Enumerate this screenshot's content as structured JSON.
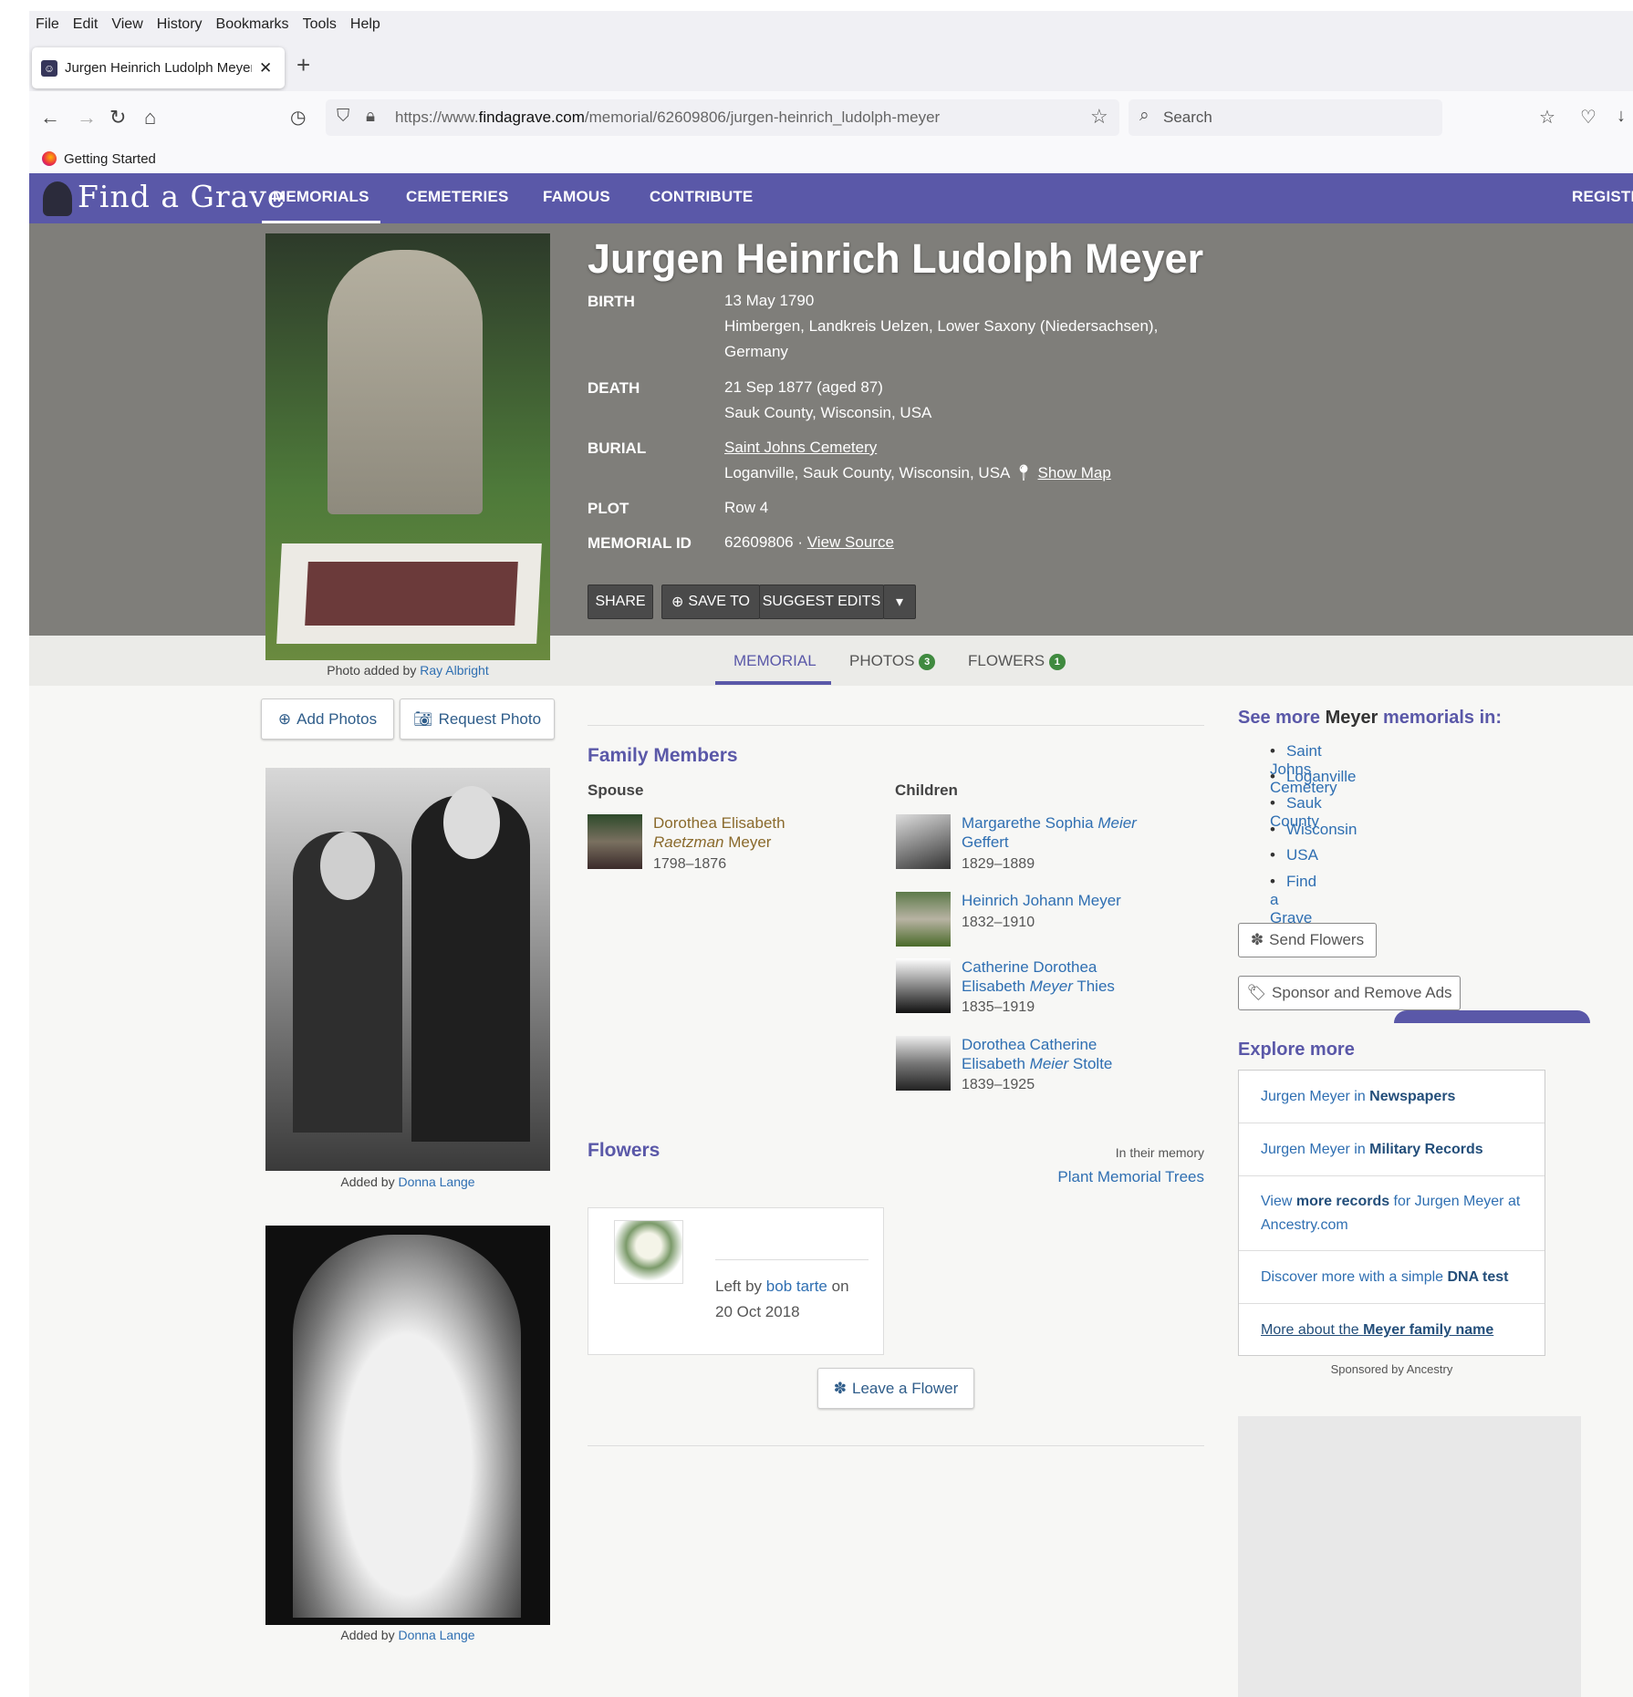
{
  "browser": {
    "menu": [
      "File",
      "Edit",
      "View",
      "History",
      "Bookmarks",
      "Tools",
      "Help"
    ],
    "tab_title": "Jurgen Heinrich Ludolph Meyer",
    "url_prefix": "https://www.",
    "url_domain": "findagrave.com",
    "url_path": "/memorial/62609806/jurgen-heinrich_ludolph-meyer",
    "search_placeholder": "Search",
    "bookmark": "Getting Started"
  },
  "site": {
    "logo": "Find a Grave",
    "nav": [
      "MEMORIALS",
      "CEMETERIES",
      "FAMOUS",
      "CONTRIBUTE"
    ],
    "register": "REGISTE"
  },
  "memorial": {
    "name": "Jurgen Heinrich Ludolph Meyer",
    "photo_caption_prefix": "Photo added by",
    "photo_caption_user": "Ray Albright",
    "birth_label": "BIRTH",
    "birth_date": "13 May 1790",
    "birth_place_1": "Himbergen, Landkreis Uelzen, Lower Saxony (Niedersachsen),",
    "birth_place_2": "Germany",
    "death_label": "DEATH",
    "death_date": "21 Sep 1877 (aged 87)",
    "death_place": "Sauk County, Wisconsin, USA",
    "burial_label": "BURIAL",
    "burial_cemetery": "Saint Johns Cemetery",
    "burial_place": "Loganville, Sauk County, Wisconsin, USA",
    "show_map": "Show Map",
    "plot_label": "PLOT",
    "plot": "Row 4",
    "memorial_id_label": "MEMORIAL ID",
    "memorial_id": "62609806 ·",
    "view_source": "View Source",
    "share": "SHARE",
    "save_to": "SAVE TO",
    "suggest_edits": "SUGGEST EDITS"
  },
  "tabs": {
    "memorial": "MEMORIAL",
    "photos": "PHOTOS",
    "photos_count": "3",
    "flowers": "FLOWERS",
    "flowers_count": "1"
  },
  "left": {
    "add_photos": "Add Photos",
    "request_photo": "Request Photo",
    "added_by": "Added by",
    "photo2_user": "Donna Lange",
    "photo3_user": "Donna Lange"
  },
  "family": {
    "title": "Family Members",
    "spouse_label": "Spouse",
    "children_label": "Children",
    "spouse": {
      "line1": "Dorothea Elisabeth",
      "line2_italic": "Raetzman",
      "line2_rest": " Meyer",
      "years": "1798–1876"
    },
    "children": [
      {
        "line1a": "Margarethe Sophia ",
        "line1_italic": "Meier",
        "line2": "Geffert",
        "years": "1829–1889"
      },
      {
        "line1a": "Heinrich Johann Meyer",
        "line1_italic": "",
        "line2": "",
        "years": "1832–1910"
      },
      {
        "line1a": "Catherine Dorothea",
        "line1_italic": "",
        "line2a": "Elisabeth ",
        "line2_italic": "Meyer",
        "line2": " Thies",
        "years": "1835–1919"
      },
      {
        "line1a": "Dorothea Catherine",
        "line1_italic": "",
        "line2a": "Elisabeth ",
        "line2_italic": "Meier",
        "line2": " Stolte",
        "years": "1839–1925"
      }
    ]
  },
  "flowers": {
    "title": "Flowers",
    "in_memory": "In their memory",
    "plant_trees": "Plant Memorial Trees",
    "left_by": "Left by",
    "left_by_user": "bob tarte",
    "left_on": "on",
    "left_date": "20 Oct 2018",
    "leave_flower": "Leave a Flower"
  },
  "sidebar": {
    "see_more_prefix": "See more",
    "see_more_name": "Meyer",
    "see_more_suffix": "memorials in:",
    "places": [
      "Saint Johns Cemetery",
      "Loganville",
      "Sauk County",
      "Wisconsin",
      "USA",
      "Find a Grave"
    ],
    "send_flowers": "Send Flowers",
    "sponsor": "Sponsor and Remove Ads",
    "explore_title": "Explore more",
    "explore": [
      {
        "pre": "Jurgen Meyer in ",
        "bold": "Newspapers",
        "post": ""
      },
      {
        "pre": "Jurgen Meyer in ",
        "bold": "Military Records",
        "post": ""
      },
      {
        "pre": "View ",
        "bold": "more records",
        "post": " for Jurgen Meyer at Ancestry.com"
      },
      {
        "pre": "Discover more with a simple ",
        "bold": "DNA test",
        "post": ""
      },
      {
        "pre": "More about the ",
        "bold": "Meyer family name",
        "post": ""
      }
    ],
    "sponsored": "Sponsored by Ancestry"
  },
  "colors": {
    "site_nav": "#5a58a8",
    "hero": "#7f7e7a",
    "link": "#2f6fb2",
    "badge": "#3f8a3f"
  }
}
